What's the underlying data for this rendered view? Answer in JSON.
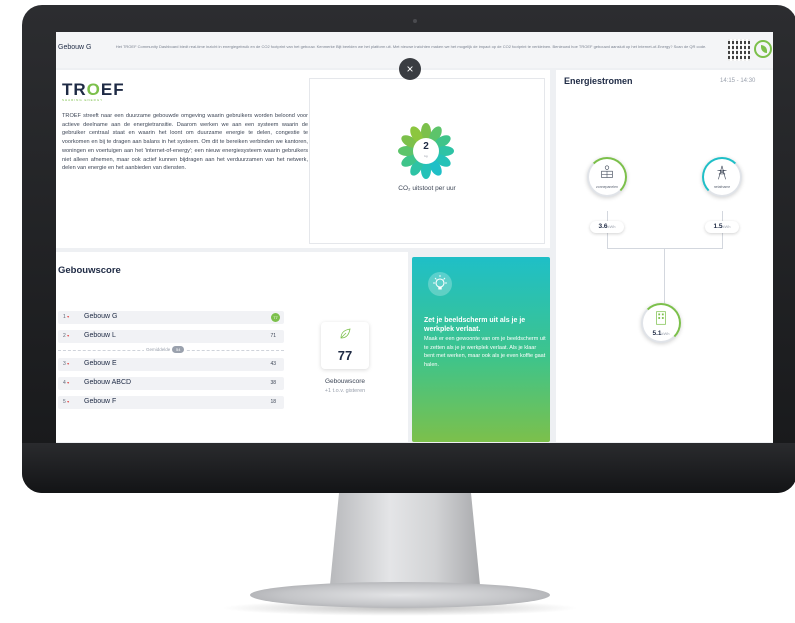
{
  "header": {
    "building": "Gebouw G",
    "notice": "Het TROEF Community Dashboard biedt real-time inzicht in energiegebruik en de CO2 footprint van het gebouw. Kenmerke Bijt beelden we het platform uit. Met nieuwe inzichten maken we het mogelijk de impact op de CO2 footprint te verkleinen. Benieuwd hoe TROEF gebouwd aansluit op het Internet-of-Energy? Scan de QR code."
  },
  "intro": {
    "logo": "TROEF",
    "logo_sub": "SHARING ENERGY",
    "text": "TROEF streeft naar een duurzame gebouwde omgeving waarin gebruikers worden beloond voor actieve deelname aan de energietransitie. Daarom werken we aan een systeem waarin de gebruiker centraal staat en waarin het loont om duurzame energie te delen, congestie te voorkomen en bij te dragen aan balans in het systeem. Om dit te bereiken verbinden we kantoren, woningen en voertuigen aan het 'internet-of-energy'; een nieuw energiesysteem waarin gebruikers niet alleen afnemen, maar ook actief kunnen bijdragen aan het verduurzamen van het netwerk, delen van energie en het aanbieden van diensten."
  },
  "co2": {
    "value": "2",
    "unit": "kg",
    "label": "CO₂ uitstoot per uur"
  },
  "gebouwscore": {
    "title": "Gebouwscore",
    "rows": [
      {
        "rank": "1",
        "name": "Gebouw G",
        "score": "77"
      },
      {
        "rank": "2",
        "name": "Gebouw L",
        "score": "71"
      },
      {
        "rank": "3",
        "name": "Gebouw E",
        "score": "43"
      },
      {
        "rank": "4",
        "name": "Gebouw ABCD",
        "score": "38"
      },
      {
        "rank": "5",
        "name": "Gebouw F",
        "score": "18"
      }
    ],
    "average_label": "Gemiddelde",
    "average_value": "54",
    "score_value": "77",
    "score_label": "Gebouwscore",
    "score_delta": "+1 t.o.v. gisteren"
  },
  "tip": {
    "title": "Zet je beeldscherm uit als je je werkplek verlaat.",
    "body": "Maak er een gewoonte van om je beeldscherm uit te zetten als je je werkplek verlaat. Als je klaar bent met werken, maar ook als je even koffie gaat halen."
  },
  "energie": {
    "title": "Energiestromen",
    "time": "14:15 - 14:30",
    "nodes": [
      {
        "label": "zonnepanelen",
        "value": "3.6",
        "unit": "kWh"
      },
      {
        "label": "netafname",
        "value": "1.5",
        "unit": "kWh"
      },
      {
        "label": "gebouw",
        "value": "5.1",
        "unit": "kWh"
      }
    ]
  },
  "close_symbol": "×",
  "colors": {
    "accent_green": "#7cc04b",
    "accent_teal": "#1fbfc7",
    "navy": "#1e2a44"
  }
}
